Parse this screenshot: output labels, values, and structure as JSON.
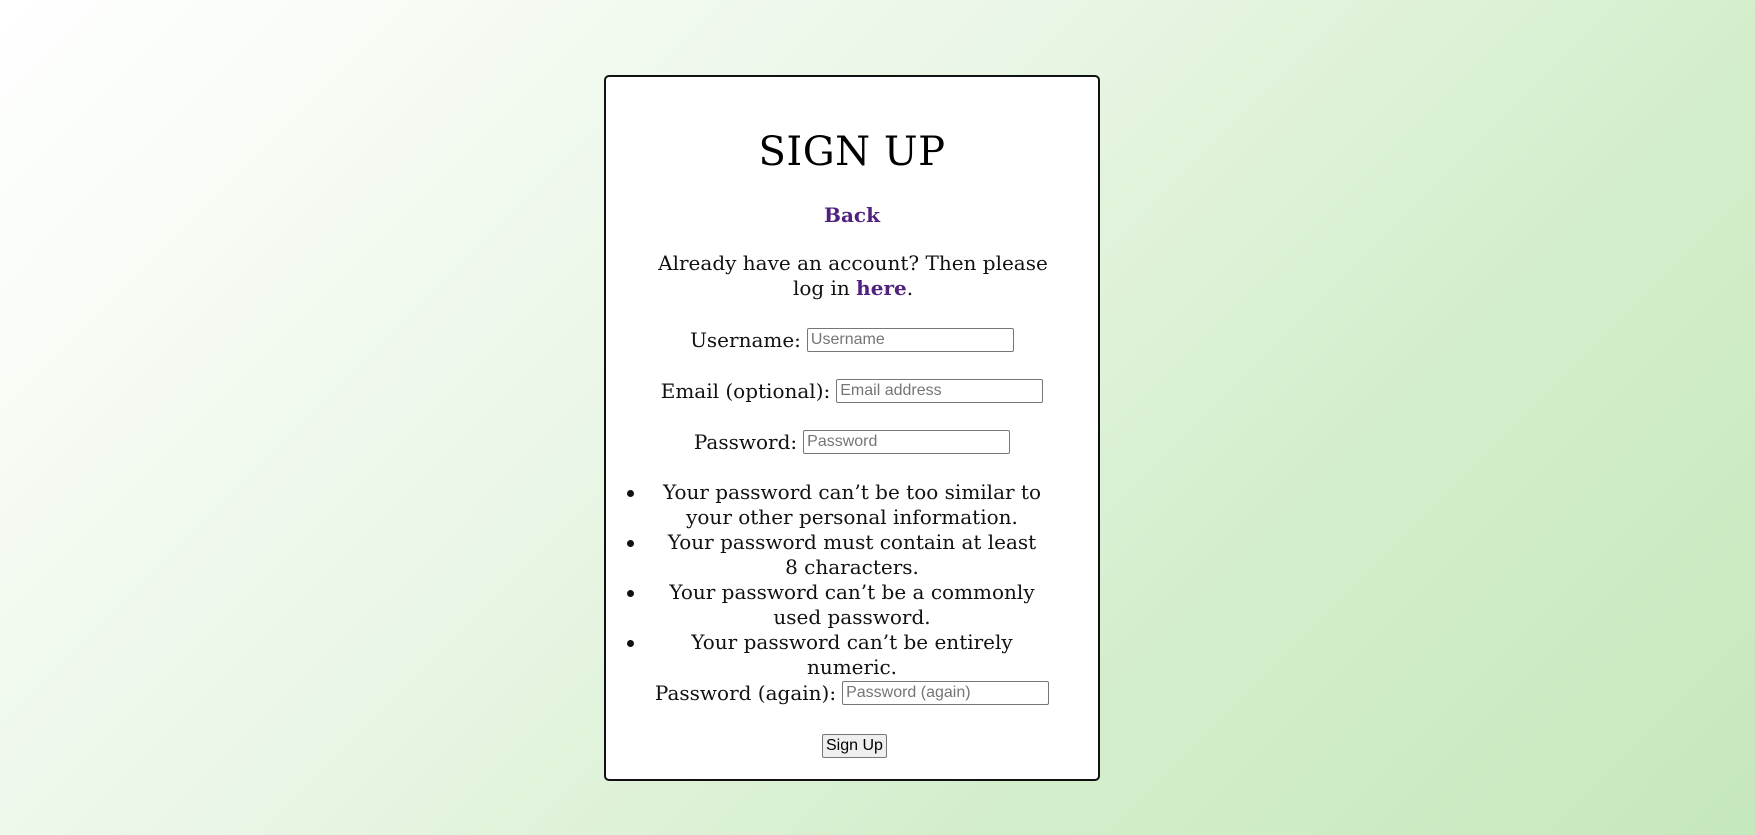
{
  "page": {
    "title": "SIGN UP",
    "back_link": "Back",
    "login_prompt": {
      "text_before": "Already have an account? Then please log in ",
      "link": "here",
      "text_after": "."
    }
  },
  "form": {
    "username": {
      "label": "Username:",
      "placeholder": "Username"
    },
    "email": {
      "label": "Email (optional):",
      "placeholder": "Email address"
    },
    "password": {
      "label": "Password:",
      "placeholder": "Password"
    },
    "password_rules": [
      "Your password can’t be too similar to your other personal information.",
      "Your password must contain at least 8 characters.",
      "Your password can’t be a commonly used password.",
      "Your password can’t be entirely numeric."
    ],
    "password_again": {
      "label": "Password (again):",
      "placeholder": "Password (again)"
    },
    "submit_label": "Sign Up"
  },
  "colors": {
    "link": "#51217f",
    "background_start": "#ffffff",
    "background_end": "#c6e8bd",
    "card_border": "#111111"
  }
}
